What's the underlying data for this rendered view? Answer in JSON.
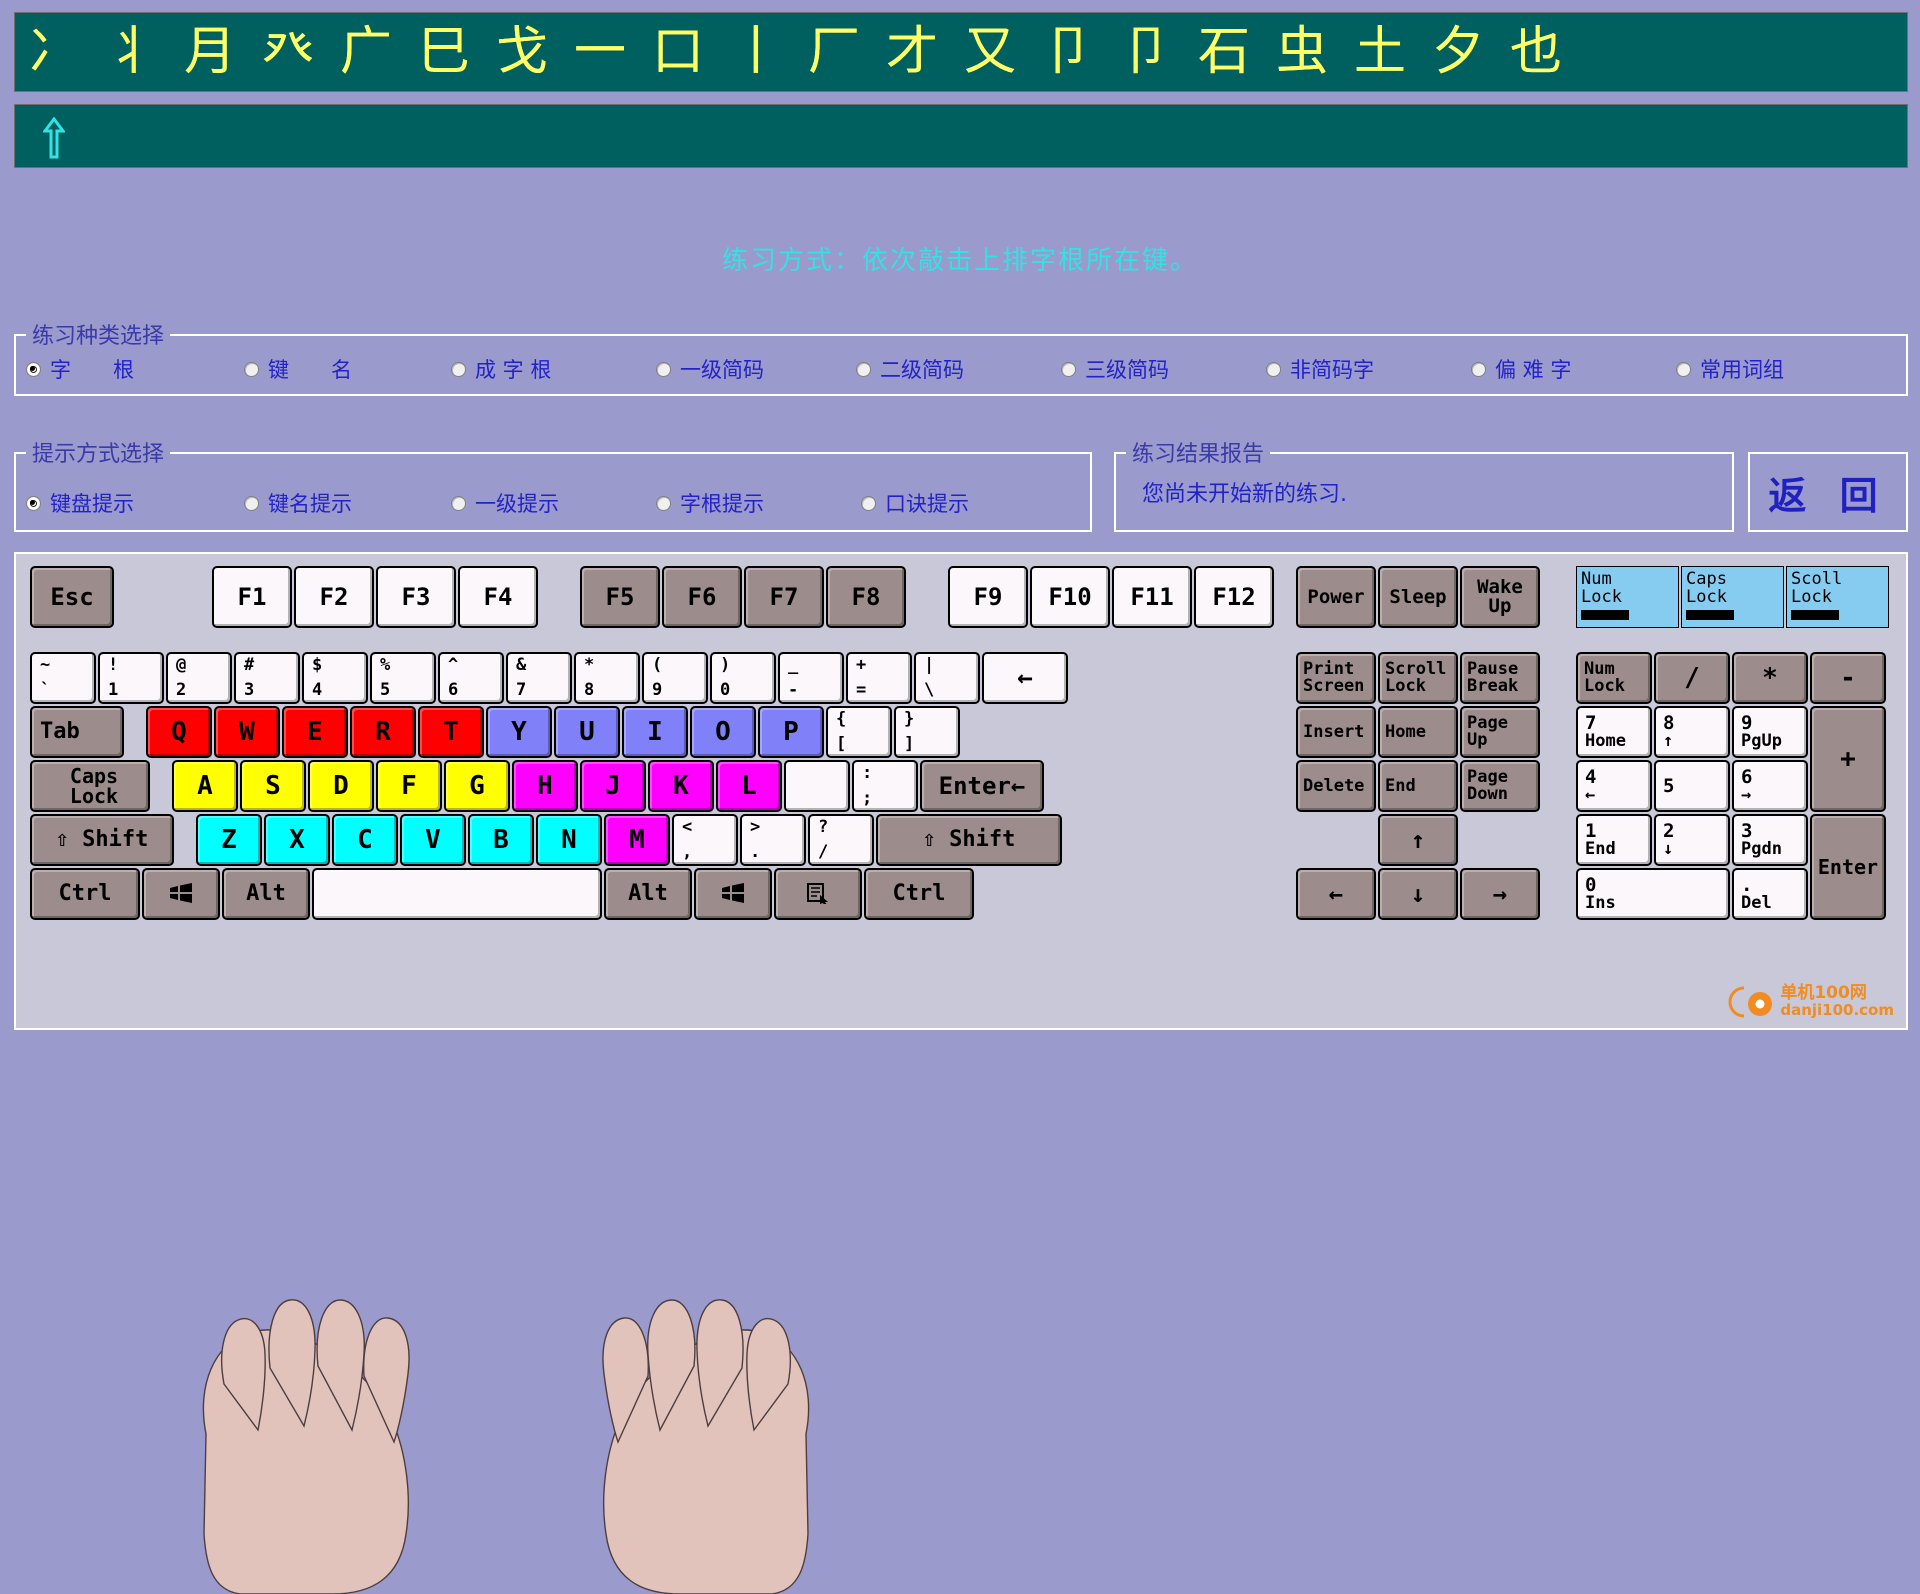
{
  "glyph_strip": {
    "chars": [
      "冫",
      "丬",
      "月",
      "癶",
      "广",
      "巳",
      "戈",
      "一",
      "口",
      "丨",
      "厂",
      "才",
      "又",
      "卩",
      "卩",
      "石",
      "虫",
      "土",
      "夕",
      "也"
    ],
    "bg_color": "#005f5f",
    "text_color": "#ffff66"
  },
  "input_strip": {
    "value": "",
    "caret_icon": "up-arrow-caret",
    "caret_color": "#33e2e2"
  },
  "mode_line": {
    "text": "练习方式：依次敲击上排字根所在键。",
    "color": "#33e2e2"
  },
  "kind_group": {
    "legend": "练习种类选择",
    "options": [
      {
        "label": "字　　根",
        "selected": true
      },
      {
        "label": "键　　名",
        "selected": false
      },
      {
        "label": "成 字 根",
        "selected": false
      },
      {
        "label": "一级简码",
        "selected": false
      },
      {
        "label": "二级简码",
        "selected": false
      },
      {
        "label": "三级简码",
        "selected": false
      },
      {
        "label": "非简码字",
        "selected": false
      },
      {
        "label": "偏 难 字",
        "selected": false
      },
      {
        "label": "常用词组",
        "selected": false
      }
    ]
  },
  "hint_group": {
    "legend": "提示方式选择",
    "options": [
      {
        "label": "键盘提示",
        "selected": true
      },
      {
        "label": "键名提示",
        "selected": false
      },
      {
        "label": "一级提示",
        "selected": false
      },
      {
        "label": "字根提示",
        "selected": false
      },
      {
        "label": "口诀提示",
        "selected": false
      }
    ]
  },
  "report_group": {
    "legend": "练习结果报告",
    "text": "您尚未开始新的练习."
  },
  "back_button": {
    "label": "返 回"
  },
  "keyboard": {
    "fn_row": [
      {
        "label": "Esc",
        "color": "grey"
      },
      {
        "label": "F1",
        "color": "white"
      },
      {
        "label": "F2",
        "color": "white"
      },
      {
        "label": "F3",
        "color": "white"
      },
      {
        "label": "F4",
        "color": "white"
      },
      {
        "label": "F5",
        "color": "grey"
      },
      {
        "label": "F6",
        "color": "grey"
      },
      {
        "label": "F7",
        "color": "grey"
      },
      {
        "label": "F8",
        "color": "grey"
      },
      {
        "label": "F9",
        "color": "white"
      },
      {
        "label": "F10",
        "color": "white"
      },
      {
        "label": "F11",
        "color": "white"
      },
      {
        "label": "F12",
        "color": "white"
      }
    ],
    "power_keys": [
      {
        "top": "Power",
        "bot": ""
      },
      {
        "top": "Sleep",
        "bot": ""
      },
      {
        "top": "Wake",
        "bot": "Up"
      }
    ],
    "leds": [
      {
        "top": "Num",
        "bot": "Lock"
      },
      {
        "top": "Caps",
        "bot": "Lock"
      },
      {
        "top": "Scoll",
        "bot": "Lock"
      }
    ],
    "num_row": [
      {
        "top": "~",
        "bot": "`",
        "color": "white"
      },
      {
        "top": "!",
        "bot": "1",
        "color": "white"
      },
      {
        "top": "@",
        "bot": "2",
        "color": "white"
      },
      {
        "top": "#",
        "bot": "3",
        "color": "white"
      },
      {
        "top": "$",
        "bot": "4",
        "color": "white"
      },
      {
        "top": "%",
        "bot": "5",
        "color": "white"
      },
      {
        "top": "^",
        "bot": "6",
        "color": "white"
      },
      {
        "top": "&",
        "bot": "7",
        "color": "white"
      },
      {
        "top": "*",
        "bot": "8",
        "color": "white"
      },
      {
        "top": "(",
        "bot": "9",
        "color": "white"
      },
      {
        "top": ")",
        "bot": "0",
        "color": "white"
      },
      {
        "top": "_",
        "bot": "-",
        "color": "white"
      },
      {
        "top": "+",
        "bot": "=",
        "color": "white"
      },
      {
        "top": "|",
        "bot": "\\",
        "color": "white"
      }
    ],
    "backspace": {
      "label": "←",
      "color": "white"
    },
    "tab": {
      "label": "Tab",
      "color": "grey"
    },
    "q_row": [
      {
        "label": "Q",
        "color": "red"
      },
      {
        "label": "W",
        "color": "red"
      },
      {
        "label": "E",
        "color": "red"
      },
      {
        "label": "R",
        "color": "red"
      },
      {
        "label": "T",
        "color": "red"
      },
      {
        "label": "Y",
        "color": "blue"
      },
      {
        "label": "U",
        "color": "blue"
      },
      {
        "label": "I",
        "color": "blue"
      },
      {
        "label": "O",
        "color": "blue"
      },
      {
        "label": "P",
        "color": "blue"
      }
    ],
    "q_row_tail": [
      {
        "top": "{",
        "bot": "[",
        "color": "white"
      },
      {
        "top": "}",
        "bot": "]",
        "color": "white"
      }
    ],
    "caps": {
      "label": "Caps Lock",
      "color": "grey"
    },
    "a_row": [
      {
        "label": "A",
        "color": "yellow"
      },
      {
        "label": "S",
        "color": "yellow"
      },
      {
        "label": "D",
        "color": "yellow"
      },
      {
        "label": "F",
        "color": "yellow"
      },
      {
        "label": "G",
        "color": "yellow"
      },
      {
        "label": "H",
        "color": "magenta"
      },
      {
        "label": "J",
        "color": "magenta"
      },
      {
        "label": "K",
        "color": "magenta"
      },
      {
        "label": "L",
        "color": "magenta"
      }
    ],
    "a_row_tail": [
      {
        "top": "",
        "bot": "",
        "color": "white"
      },
      {
        "top": ":",
        "bot": ";",
        "color": "white"
      }
    ],
    "enter": {
      "label": "Enter←",
      "color": "grey"
    },
    "lshift": {
      "label": "⇧ Shift",
      "color": "grey"
    },
    "z_row": [
      {
        "label": "Z",
        "color": "cyan"
      },
      {
        "label": "X",
        "color": "cyan"
      },
      {
        "label": "C",
        "color": "cyan"
      },
      {
        "label": "V",
        "color": "cyan"
      },
      {
        "label": "B",
        "color": "cyan"
      },
      {
        "label": "N",
        "color": "cyan"
      },
      {
        "label": "M",
        "color": "magenta"
      }
    ],
    "z_row_tail": [
      {
        "top": "<",
        "bot": ",",
        "color": "white"
      },
      {
        "top": ">",
        "bot": ".",
        "color": "white"
      },
      {
        "top": "?",
        "bot": "/",
        "color": "white"
      }
    ],
    "rshift": {
      "label": "⇧ Shift",
      "color": "grey"
    },
    "bottom_row": [
      {
        "label": "Ctrl",
        "color": "grey",
        "icon": ""
      },
      {
        "label": "",
        "color": "grey",
        "icon": "windows-icon"
      },
      {
        "label": "Alt",
        "color": "grey",
        "icon": ""
      },
      {
        "label": "",
        "color": "white",
        "icon": ""
      },
      {
        "label": "Alt",
        "color": "grey",
        "icon": ""
      },
      {
        "label": "",
        "color": "grey",
        "icon": "windows-icon"
      },
      {
        "label": "",
        "color": "grey",
        "icon": "menu-icon"
      },
      {
        "label": "Ctrl",
        "color": "grey",
        "icon": ""
      }
    ],
    "nav_cluster": [
      {
        "top": "Print",
        "bot": "Screen"
      },
      {
        "top": "Scroll",
        "bot": "Lock"
      },
      {
        "top": "Pause",
        "bot": "Break"
      },
      {
        "top": "Insert",
        "bot": ""
      },
      {
        "top": "Home",
        "bot": ""
      },
      {
        "top": "Page",
        "bot": "Up"
      },
      {
        "top": "Delete",
        "bot": ""
      },
      {
        "top": "End",
        "bot": ""
      },
      {
        "top": "Page",
        "bot": "Down"
      }
    ],
    "arrows": [
      {
        "label": "↑"
      },
      {
        "label": "←"
      },
      {
        "label": "↓"
      },
      {
        "label": "→"
      }
    ],
    "numpad_top": [
      {
        "top": "Num",
        "bot": "Lock",
        "color": "grey"
      },
      {
        "top": "/",
        "bot": "",
        "color": "grey"
      },
      {
        "top": "*",
        "bot": "",
        "color": "grey"
      },
      {
        "top": "-",
        "bot": "",
        "color": "grey"
      }
    ],
    "numpad": [
      {
        "top": "7",
        "bot": "Home",
        "color": "white"
      },
      {
        "top": "8",
        "bot": "↑",
        "color": "white"
      },
      {
        "top": "9",
        "bot": "PgUp",
        "color": "white"
      },
      {
        "top": "4",
        "bot": "←",
        "color": "white"
      },
      {
        "top": "5",
        "bot": "",
        "color": "white"
      },
      {
        "top": "6",
        "bot": "→",
        "color": "white"
      },
      {
        "top": "1",
        "bot": "End",
        "color": "white"
      },
      {
        "top": "2",
        "bot": "↓",
        "color": "white"
      },
      {
        "top": "3",
        "bot": "Pgdn",
        "color": "white"
      },
      {
        "top": "0",
        "bot": "Ins",
        "color": "white"
      },
      {
        "top": ".",
        "bot": "Del",
        "color": "white"
      }
    ],
    "numpad_plus": {
      "label": "+",
      "color": "grey"
    },
    "numpad_enter": {
      "label": "Enter",
      "color": "grey"
    }
  },
  "watermark": {
    "line1": "单机100网",
    "line2": "danji100.com",
    "color": "#f08c20"
  }
}
